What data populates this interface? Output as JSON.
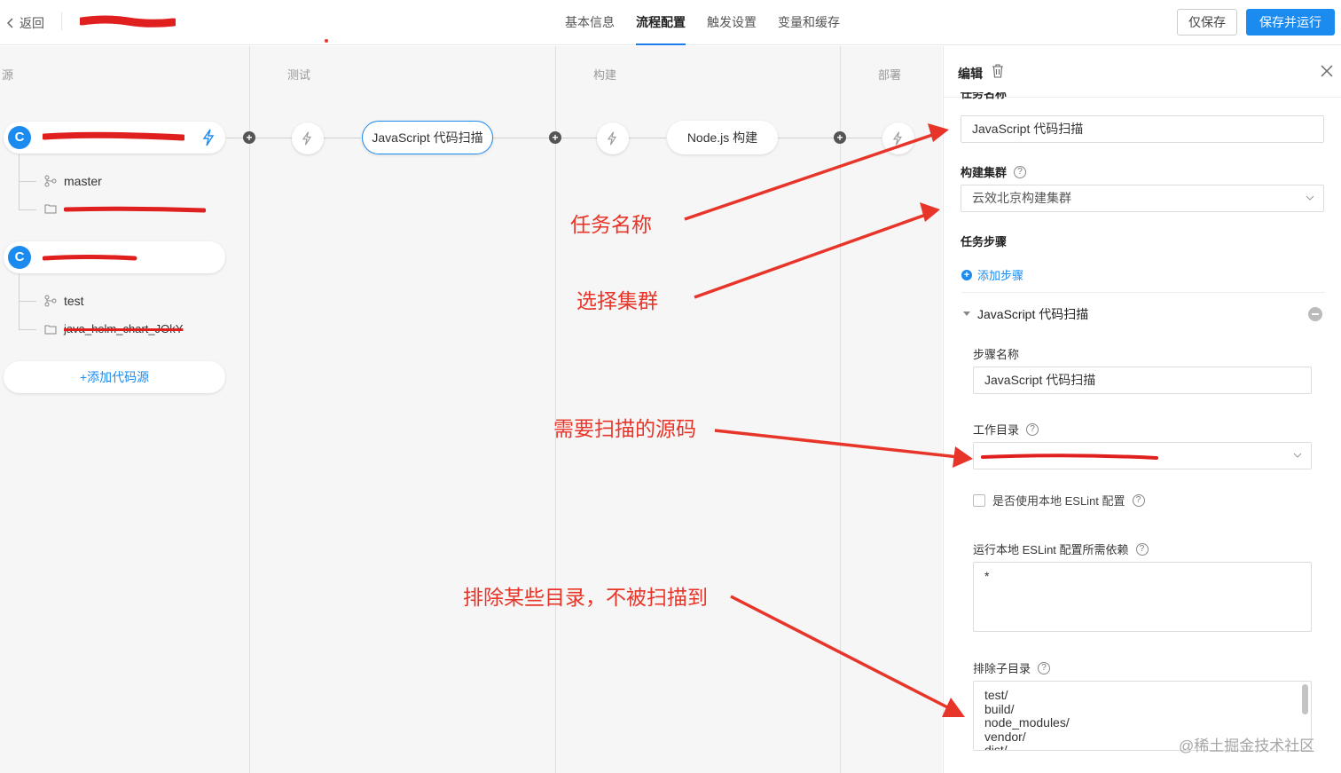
{
  "header": {
    "back_label": "返回",
    "tabs": [
      {
        "label": "基本信息",
        "active": false
      },
      {
        "label": "流程配置",
        "active": true
      },
      {
        "label": "触发设置",
        "active": false
      },
      {
        "label": "变量和缓存",
        "active": false
      }
    ],
    "save_label": "仅保存",
    "save_run_label": "保存并运行"
  },
  "pipeline": {
    "stages": [
      "源",
      "测试",
      "构建",
      "部署"
    ],
    "sources": [
      {
        "branch": "master"
      },
      {
        "branch": "test",
        "folder": "java_helm_chart_JOkY"
      }
    ],
    "add_source_label": "+添加代码源",
    "jobs": [
      {
        "label": "JavaScript 代码扫描",
        "selected": true
      },
      {
        "label": "Node.js 构建",
        "selected": false
      }
    ]
  },
  "annotations": [
    "任务名称",
    "选择集群",
    "需要扫描的源码",
    "排除某些目录，不被扫描到"
  ],
  "panel": {
    "title": "编辑",
    "task_name_label": "任务名称",
    "task_name_value": "JavaScript 代码扫描",
    "cluster_label": "构建集群",
    "cluster_value": "云效北京构建集群",
    "steps_label": "任务步骤",
    "add_step_label": "添加步骤",
    "step": {
      "title": "JavaScript 代码扫描",
      "name_label": "步骤名称",
      "name_value": "JavaScript 代码扫描",
      "workdir_label": "工作目录",
      "eslint_checkbox_label": "是否使用本地 ESLint 配置",
      "deps_label": "运行本地 ESLint 配置所需依赖",
      "deps_value": "*",
      "exclude_label": "排除子目录",
      "exclude_lines": [
        "test/",
        "build/",
        "node_modules/",
        "vendor/",
        "dist/"
      ]
    }
  },
  "watermark": "@稀土掘金技术社区",
  "colors": {
    "accent": "#1b8bf0",
    "annotation": "#e8352a"
  }
}
